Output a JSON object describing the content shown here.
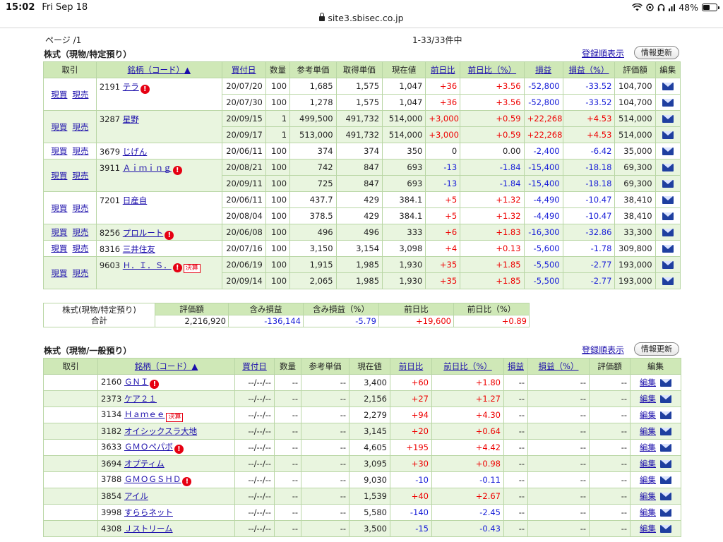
{
  "statusbar": {
    "time": "15:02",
    "date": "Fri Sep 18",
    "battery": "48%"
  },
  "url": "site3.sbisec.co.jp",
  "page_info": {
    "page": "ページ /1",
    "count": "1-33/33件中"
  },
  "section1": {
    "title": "株式（現物/特定預り）",
    "order_link": "登録順表示",
    "refresh_button": "情報更新",
    "headers": [
      "取引",
      "銘柄（コード）▲",
      "買付日",
      "数量",
      "参考単価",
      "取得単価",
      "現在値",
      "前日比",
      "前日比（%）",
      "損益",
      "損益（%）",
      "評価額",
      "編集"
    ],
    "trade_labels": [
      "現買",
      "現売"
    ],
    "groups": [
      {
        "code": "2191",
        "name": "テラ",
        "alert": true,
        "kessan": false,
        "rows": [
          {
            "date": "20/07/20",
            "qty": "100",
            "ref": "1,685",
            "cost": "1,575",
            "price": "1,047",
            "chg": "+36",
            "chgp": "+3.56",
            "pl": "-52,800",
            "plp": "-33.52",
            "val": "104,700"
          },
          {
            "date": "20/07/30",
            "qty": "100",
            "ref": "1,278",
            "cost": "1,575",
            "price": "1,047",
            "chg": "+36",
            "chgp": "+3.56",
            "pl": "-52,800",
            "plp": "-33.52",
            "val": "104,700"
          }
        ]
      },
      {
        "code": "3287",
        "name": "星野",
        "alert": false,
        "kessan": false,
        "rows": [
          {
            "date": "20/09/15",
            "qty": "1",
            "ref": "499,500",
            "cost": "491,732",
            "price": "514,000",
            "chg": "+3,000",
            "chgp": "+0.59",
            "pl": "+22,268",
            "plp": "+4.53",
            "val": "514,000"
          },
          {
            "date": "20/09/17",
            "qty": "1",
            "ref": "513,000",
            "cost": "491,732",
            "price": "514,000",
            "chg": "+3,000",
            "chgp": "+0.59",
            "pl": "+22,268",
            "plp": "+4.53",
            "val": "514,000"
          }
        ]
      },
      {
        "code": "3679",
        "name": "じげん",
        "alert": false,
        "kessan": false,
        "rows": [
          {
            "date": "20/06/11",
            "qty": "100",
            "ref": "374",
            "cost": "374",
            "price": "350",
            "chg": "0",
            "chgp": "0.00",
            "pl": "-2,400",
            "plp": "-6.42",
            "val": "35,000"
          }
        ]
      },
      {
        "code": "3911",
        "name": "Ａｉｍｉｎｇ",
        "alert": true,
        "kessan": false,
        "rows": [
          {
            "date": "20/08/21",
            "qty": "100",
            "ref": "742",
            "cost": "847",
            "price": "693",
            "chg": "-13",
            "chgp": "-1.84",
            "pl": "-15,400",
            "plp": "-18.18",
            "val": "69,300"
          },
          {
            "date": "20/09/11",
            "qty": "100",
            "ref": "725",
            "cost": "847",
            "price": "693",
            "chg": "-13",
            "chgp": "-1.84",
            "pl": "-15,400",
            "plp": "-18.18",
            "val": "69,300"
          }
        ]
      },
      {
        "code": "7201",
        "name": "日産自",
        "alert": false,
        "kessan": false,
        "rows": [
          {
            "date": "20/06/11",
            "qty": "100",
            "ref": "437.7",
            "cost": "429",
            "price": "384.1",
            "chg": "+5",
            "chgp": "+1.32",
            "pl": "-4,490",
            "plp": "-10.47",
            "val": "38,410"
          },
          {
            "date": "20/08/04",
            "qty": "100",
            "ref": "378.5",
            "cost": "429",
            "price": "384.1",
            "chg": "+5",
            "chgp": "+1.32",
            "pl": "-4,490",
            "plp": "-10.47",
            "val": "38,410"
          }
        ]
      },
      {
        "code": "8256",
        "name": "プロルート",
        "alert": true,
        "kessan": false,
        "rows": [
          {
            "date": "20/06/08",
            "qty": "100",
            "ref": "496",
            "cost": "496",
            "price": "333",
            "chg": "+6",
            "chgp": "+1.83",
            "pl": "-16,300",
            "plp": "-32.86",
            "val": "33,300"
          }
        ]
      },
      {
        "code": "8316",
        "name": "三井住友",
        "alert": false,
        "kessan": false,
        "rows": [
          {
            "date": "20/07/16",
            "qty": "100",
            "ref": "3,150",
            "cost": "3,154",
            "price": "3,098",
            "chg": "+4",
            "chgp": "+0.13",
            "pl": "-5,600",
            "plp": "-1.78",
            "val": "309,800"
          }
        ]
      },
      {
        "code": "9603",
        "name": "Ｈ．Ｉ．Ｓ．",
        "alert": true,
        "kessan": true,
        "rows": [
          {
            "date": "20/06/19",
            "qty": "100",
            "ref": "1,915",
            "cost": "1,985",
            "price": "1,930",
            "chg": "+35",
            "chgp": "+1.85",
            "pl": "-5,500",
            "plp": "-2.77",
            "val": "193,000"
          },
          {
            "date": "20/09/14",
            "qty": "100",
            "ref": "2,065",
            "cost": "1,985",
            "price": "1,930",
            "chg": "+35",
            "chgp": "+1.85",
            "pl": "-5,500",
            "plp": "-2.77",
            "val": "193,000"
          }
        ]
      }
    ]
  },
  "summary": {
    "label_line1": "株式(現物/特定預り)",
    "label_line2": "合計",
    "headers": [
      "評価額",
      "含み損益",
      "含み損益（%）",
      "前日比",
      "前日比（%）"
    ],
    "values": [
      "2,216,920",
      "-136,144",
      "-5.79",
      "+19,600",
      "+0.89"
    ]
  },
  "section2": {
    "title": "株式（現物/一般預り）",
    "order_link": "登録順表示",
    "refresh_button": "情報更新",
    "headers": [
      "取引",
      "銘柄（コード）▲",
      "買付日",
      "数量",
      "参考単価",
      "現在値",
      "前日比",
      "前日比（%）",
      "損益",
      "損益（%）",
      "評価額",
      "編集"
    ],
    "edit_label": "編集",
    "rows": [
      {
        "code": "2160",
        "name": "ＧＮＩ",
        "alert": true,
        "kessan": false,
        "date": "--/--/--",
        "qty": "--",
        "ref": "--",
        "price": "3,400",
        "chg": "+60",
        "chgp": "+1.80",
        "pl": "--",
        "plp": "--",
        "val": "--"
      },
      {
        "code": "2373",
        "name": "ケア２１",
        "alert": false,
        "kessan": false,
        "date": "--/--/--",
        "qty": "--",
        "ref": "--",
        "price": "2,156",
        "chg": "+27",
        "chgp": "+1.27",
        "pl": "--",
        "plp": "--",
        "val": "--"
      },
      {
        "code": "3134",
        "name": "Ｈａｍｅｅ",
        "alert": false,
        "kessan": true,
        "date": "--/--/--",
        "qty": "--",
        "ref": "--",
        "price": "2,279",
        "chg": "+94",
        "chgp": "+4.30",
        "pl": "--",
        "plp": "--",
        "val": "--"
      },
      {
        "code": "3182",
        "name": "オイシックスラ大地",
        "alert": false,
        "kessan": false,
        "date": "--/--/--",
        "qty": "--",
        "ref": "--",
        "price": "3,145",
        "chg": "+20",
        "chgp": "+0.64",
        "pl": "--",
        "plp": "--",
        "val": "--"
      },
      {
        "code": "3633",
        "name": "ＧＭＯペパボ",
        "alert": true,
        "kessan": false,
        "date": "--/--/--",
        "qty": "--",
        "ref": "--",
        "price": "4,605",
        "chg": "+195",
        "chgp": "+4.42",
        "pl": "--",
        "plp": "--",
        "val": "--"
      },
      {
        "code": "3694",
        "name": "オプティム",
        "alert": false,
        "kessan": false,
        "date": "--/--/--",
        "qty": "--",
        "ref": "--",
        "price": "3,095",
        "chg": "+30",
        "chgp": "+0.98",
        "pl": "--",
        "plp": "--",
        "val": "--"
      },
      {
        "code": "3788",
        "name": "ＧＭＯＧＳＨＤ",
        "alert": true,
        "kessan": false,
        "date": "--/--/--",
        "qty": "--",
        "ref": "--",
        "price": "9,030",
        "chg": "-10",
        "chgp": "-0.11",
        "pl": "--",
        "plp": "--",
        "val": "--"
      },
      {
        "code": "3854",
        "name": "アイル",
        "alert": false,
        "kessan": false,
        "date": "--/--/--",
        "qty": "--",
        "ref": "--",
        "price": "1,539",
        "chg": "+40",
        "chgp": "+2.67",
        "pl": "--",
        "plp": "--",
        "val": "--"
      },
      {
        "code": "3998",
        "name": "すららネット",
        "alert": false,
        "kessan": false,
        "date": "--/--/--",
        "qty": "--",
        "ref": "--",
        "price": "5,580",
        "chg": "-140",
        "chgp": "-2.45",
        "pl": "--",
        "plp": "--",
        "val": "--"
      },
      {
        "code": "4308",
        "name": "Ｊストリーム",
        "alert": false,
        "kessan": false,
        "date": "--/--/--",
        "qty": "--",
        "ref": "--",
        "price": "3,500",
        "chg": "-15",
        "chgp": "-0.43",
        "pl": "--",
        "plp": "--",
        "val": "--"
      }
    ]
  },
  "icons": {
    "alert": "!",
    "kessan": "決算",
    "mail": "mail-icon"
  },
  "colors": {
    "header_bg": "#cfe8b7",
    "row_tint": "#e9f5df",
    "positive": "#e00000",
    "negative": "#1a20d8",
    "link": "#1a0dab"
  }
}
